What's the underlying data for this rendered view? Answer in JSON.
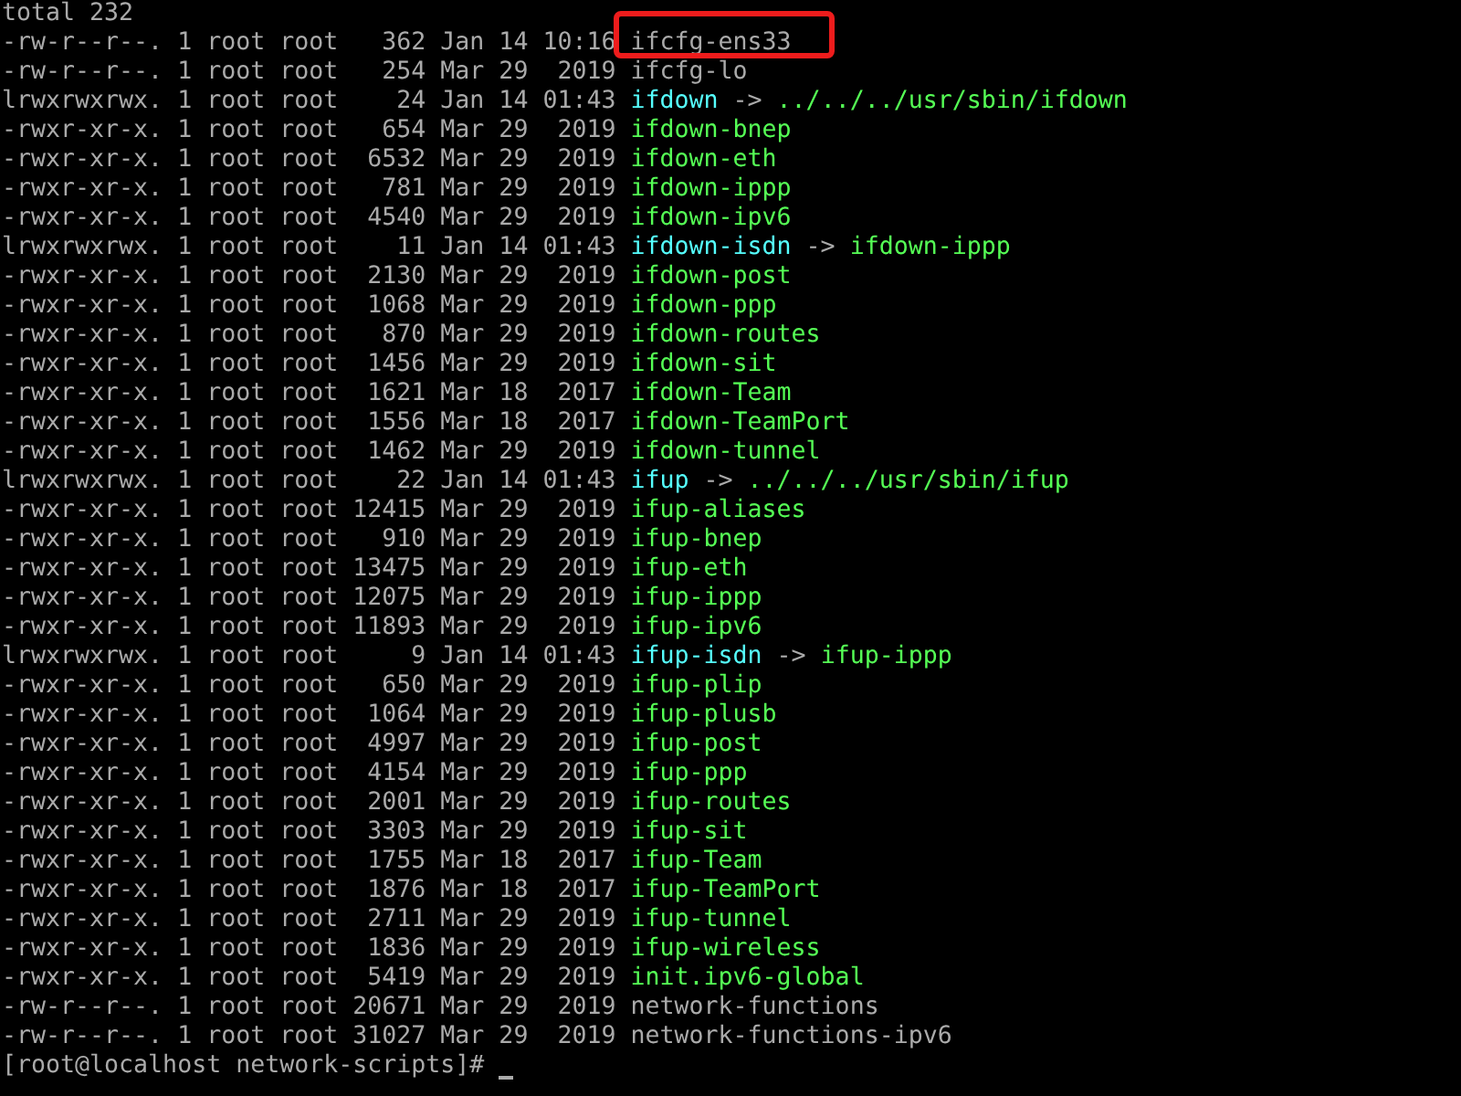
{
  "terminal": {
    "header": "total 232",
    "rows": [
      {
        "meta": "-rw-r--r--. 1 root root   362 Jan 14 10:16 ",
        "name": "ifcfg-ens33",
        "kind": "file",
        "highlighted": true
      },
      {
        "meta": "-rw-r--r--. 1 root root   254 Mar 29  2019 ",
        "name": "ifcfg-lo",
        "kind": "file",
        "highlighted": false
      },
      {
        "meta": "lrwxrwxrwx. 1 root root    24 Jan 14 01:43 ",
        "name": "ifdown",
        "kind": "link",
        "target": "../../../usr/sbin/ifdown",
        "highlighted": false
      },
      {
        "meta": "-rwxr-xr-x. 1 root root   654 Mar 29  2019 ",
        "name": "ifdown-bnep",
        "kind": "exec",
        "highlighted": false
      },
      {
        "meta": "-rwxr-xr-x. 1 root root  6532 Mar 29  2019 ",
        "name": "ifdown-eth",
        "kind": "exec",
        "highlighted": false
      },
      {
        "meta": "-rwxr-xr-x. 1 root root   781 Mar 29  2019 ",
        "name": "ifdown-ippp",
        "kind": "exec",
        "highlighted": false
      },
      {
        "meta": "-rwxr-xr-x. 1 root root  4540 Mar 29  2019 ",
        "name": "ifdown-ipv6",
        "kind": "exec",
        "highlighted": false
      },
      {
        "meta": "lrwxrwxrwx. 1 root root    11 Jan 14 01:43 ",
        "name": "ifdown-isdn",
        "kind": "link",
        "target": "ifdown-ippp",
        "highlighted": false
      },
      {
        "meta": "-rwxr-xr-x. 1 root root  2130 Mar 29  2019 ",
        "name": "ifdown-post",
        "kind": "exec",
        "highlighted": false
      },
      {
        "meta": "-rwxr-xr-x. 1 root root  1068 Mar 29  2019 ",
        "name": "ifdown-ppp",
        "kind": "exec",
        "highlighted": false
      },
      {
        "meta": "-rwxr-xr-x. 1 root root   870 Mar 29  2019 ",
        "name": "ifdown-routes",
        "kind": "exec",
        "highlighted": false
      },
      {
        "meta": "-rwxr-xr-x. 1 root root  1456 Mar 29  2019 ",
        "name": "ifdown-sit",
        "kind": "exec",
        "highlighted": false
      },
      {
        "meta": "-rwxr-xr-x. 1 root root  1621 Mar 18  2017 ",
        "name": "ifdown-Team",
        "kind": "exec",
        "highlighted": false
      },
      {
        "meta": "-rwxr-xr-x. 1 root root  1556 Mar 18  2017 ",
        "name": "ifdown-TeamPort",
        "kind": "exec",
        "highlighted": false
      },
      {
        "meta": "-rwxr-xr-x. 1 root root  1462 Mar 29  2019 ",
        "name": "ifdown-tunnel",
        "kind": "exec",
        "highlighted": false
      },
      {
        "meta": "lrwxrwxrwx. 1 root root    22 Jan 14 01:43 ",
        "name": "ifup",
        "kind": "link",
        "target": "../../../usr/sbin/ifup",
        "highlighted": false
      },
      {
        "meta": "-rwxr-xr-x. 1 root root 12415 Mar 29  2019 ",
        "name": "ifup-aliases",
        "kind": "exec",
        "highlighted": false
      },
      {
        "meta": "-rwxr-xr-x. 1 root root   910 Mar 29  2019 ",
        "name": "ifup-bnep",
        "kind": "exec",
        "highlighted": false
      },
      {
        "meta": "-rwxr-xr-x. 1 root root 13475 Mar 29  2019 ",
        "name": "ifup-eth",
        "kind": "exec",
        "highlighted": false
      },
      {
        "meta": "-rwxr-xr-x. 1 root root 12075 Mar 29  2019 ",
        "name": "ifup-ippp",
        "kind": "exec",
        "highlighted": false
      },
      {
        "meta": "-rwxr-xr-x. 1 root root 11893 Mar 29  2019 ",
        "name": "ifup-ipv6",
        "kind": "exec",
        "highlighted": false
      },
      {
        "meta": "lrwxrwxrwx. 1 root root     9 Jan 14 01:43 ",
        "name": "ifup-isdn",
        "kind": "link",
        "target": "ifup-ippp",
        "highlighted": false
      },
      {
        "meta": "-rwxr-xr-x. 1 root root   650 Mar 29  2019 ",
        "name": "ifup-plip",
        "kind": "exec",
        "highlighted": false
      },
      {
        "meta": "-rwxr-xr-x. 1 root root  1064 Mar 29  2019 ",
        "name": "ifup-plusb",
        "kind": "exec",
        "highlighted": false
      },
      {
        "meta": "-rwxr-xr-x. 1 root root  4997 Mar 29  2019 ",
        "name": "ifup-post",
        "kind": "exec",
        "highlighted": false
      },
      {
        "meta": "-rwxr-xr-x. 1 root root  4154 Mar 29  2019 ",
        "name": "ifup-ppp",
        "kind": "exec",
        "highlighted": false
      },
      {
        "meta": "-rwxr-xr-x. 1 root root  2001 Mar 29  2019 ",
        "name": "ifup-routes",
        "kind": "exec",
        "highlighted": false
      },
      {
        "meta": "-rwxr-xr-x. 1 root root  3303 Mar 29  2019 ",
        "name": "ifup-sit",
        "kind": "exec",
        "highlighted": false
      },
      {
        "meta": "-rwxr-xr-x. 1 root root  1755 Mar 18  2017 ",
        "name": "ifup-Team",
        "kind": "exec",
        "highlighted": false
      },
      {
        "meta": "-rwxr-xr-x. 1 root root  1876 Mar 18  2017 ",
        "name": "ifup-TeamPort",
        "kind": "exec",
        "highlighted": false
      },
      {
        "meta": "-rwxr-xr-x. 1 root root  2711 Mar 29  2019 ",
        "name": "ifup-tunnel",
        "kind": "exec",
        "highlighted": false
      },
      {
        "meta": "-rwxr-xr-x. 1 root root  1836 Mar 29  2019 ",
        "name": "ifup-wireless",
        "kind": "exec",
        "highlighted": false
      },
      {
        "meta": "-rwxr-xr-x. 1 root root  5419 Mar 29  2019 ",
        "name": "init.ipv6-global",
        "kind": "exec",
        "highlighted": false
      },
      {
        "meta": "-rw-r--r--. 1 root root 20671 Mar 29  2019 ",
        "name": "network-functions",
        "kind": "file",
        "highlighted": false
      },
      {
        "meta": "-rw-r--r--. 1 root root 31027 Mar 29  2019 ",
        "name": "network-functions-ipv6",
        "kind": "file",
        "highlighted": false
      }
    ],
    "arrow": "->",
    "prompt": "[root@localhost network-scripts]#"
  }
}
